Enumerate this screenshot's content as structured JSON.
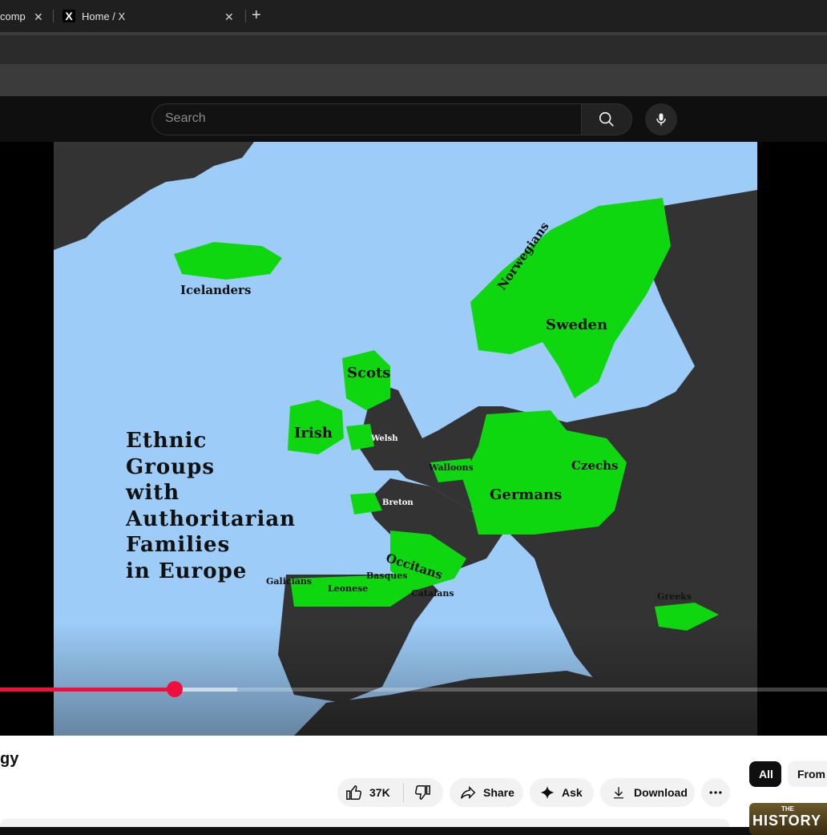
{
  "browser": {
    "tabs": [
      {
        "title": "comp",
        "close": "✕"
      },
      {
        "title": "Home / X",
        "close": "✕",
        "favicon": "X"
      }
    ],
    "new_tab": "+"
  },
  "header": {
    "search_placeholder": "Search"
  },
  "video": {
    "map_title_lines": [
      "Ethnic",
      "Groups",
      "with",
      "Authoritarian",
      "Families",
      "in Europe"
    ],
    "map_labels": {
      "icelanders": "Icelanders",
      "norwegians": "Norwegians",
      "sweden": "Sweden",
      "scots": "Scots",
      "irish": "Irish",
      "welsh": "Welsh",
      "walloons": "Walloons",
      "czechs": "Czechs",
      "germans": "Germans",
      "breton": "Breton",
      "occitans": "Occitans",
      "galicians": "Galicians",
      "basques": "Basques",
      "leonese": "Leonese",
      "catalans": "Catalans",
      "greeks": "Greeks"
    },
    "progress": {
      "played_fraction": 0.211,
      "buffered_fraction": 0.287
    },
    "colors": {
      "highlight": "#0fd70f",
      "land": "#333333",
      "sea": "#9cccf7",
      "progress": "#f00f3c"
    }
  },
  "below": {
    "title_fragment": "gy",
    "like_count": "37K",
    "share_label": "Share",
    "ask_label": "Ask",
    "download_label": "Download",
    "chips": [
      "All",
      "From"
    ],
    "thumb_small": "THE",
    "thumb_big": "HISTORY"
  }
}
